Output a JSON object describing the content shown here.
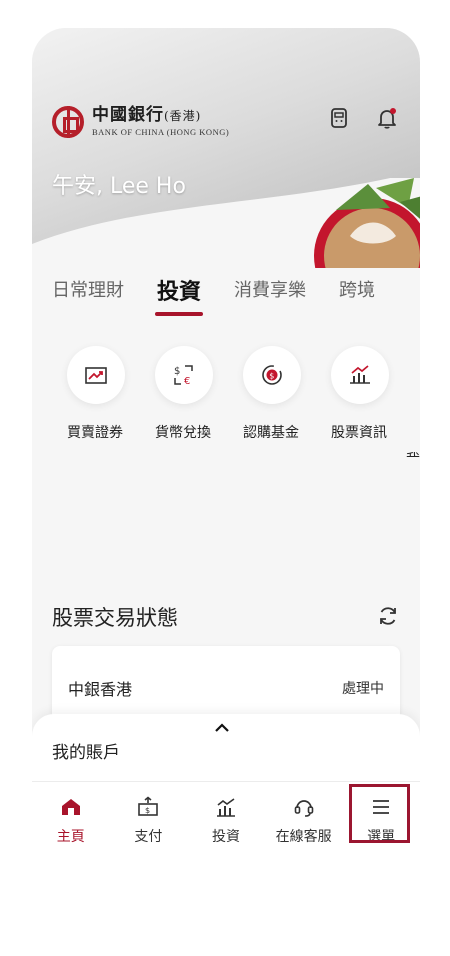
{
  "header": {
    "bank_name_cn": "中國銀行",
    "bank_name_hk": "(香港)",
    "bank_name_en": "BANK OF CHINA",
    "bank_name_en_hk": "(HONG KONG)",
    "greeting": "午安, Lee Ho"
  },
  "tabs": [
    "日常理財",
    "投資",
    "消費享樂",
    "跨境"
  ],
  "actions": [
    {
      "label": "買賣證券",
      "icon": "trade-arrows-icon"
    },
    {
      "label": "貨幣兌換",
      "icon": "currency-exchange-icon"
    },
    {
      "label": "認購基金",
      "icon": "fund-subscribe-icon"
    },
    {
      "label": "股票資訊",
      "icon": "stock-chart-icon"
    },
    {
      "label": "我",
      "icon": "partial-icon"
    }
  ],
  "stock_status": {
    "title": "股票交易狀態",
    "rows": [
      {
        "name": "中銀香港",
        "status": "處理中"
      }
    ]
  },
  "account_sheet": {
    "title": "我的賬戶"
  },
  "nav": [
    {
      "label": "主頁",
      "icon": "home-icon",
      "active": true
    },
    {
      "label": "支付",
      "icon": "payment-icon",
      "active": false
    },
    {
      "label": "投資",
      "icon": "investment-chart-icon",
      "active": false
    },
    {
      "label": "在線客服",
      "icon": "headset-icon",
      "active": false
    },
    {
      "label": "選單",
      "icon": "menu-icon",
      "active": false
    }
  ],
  "colors": {
    "brand_red": "#a8142b",
    "background": "#f6f6f6"
  }
}
